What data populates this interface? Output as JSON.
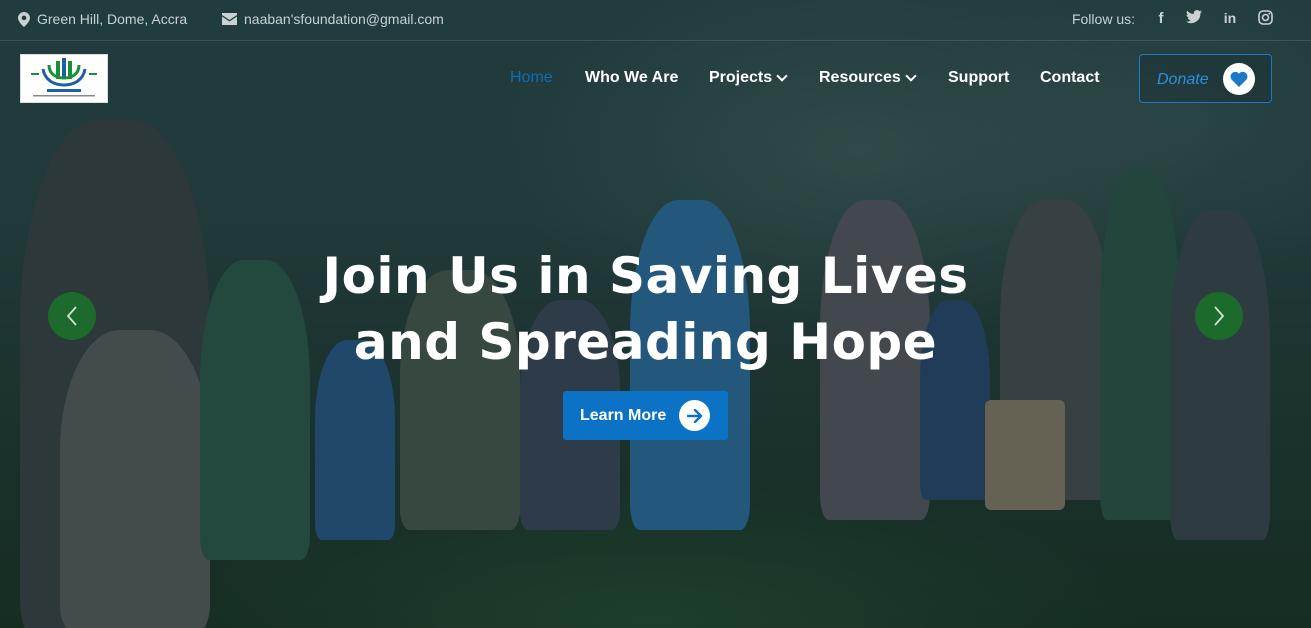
{
  "topbar": {
    "address": "Green Hill, Dome, Accra",
    "email": "naaban'sfoundation@gmail.com",
    "follow_label": "Follow us:",
    "social_icons": [
      "facebook-icon",
      "twitter-icon",
      "linkedin-icon",
      "instagram-icon"
    ]
  },
  "nav": {
    "items": [
      {
        "label": "Home",
        "active": true
      },
      {
        "label": "Who We Are"
      },
      {
        "label": "Projects",
        "dropdown": true
      },
      {
        "label": "Resources",
        "dropdown": true
      },
      {
        "label": "Support"
      },
      {
        "label": "Contact"
      }
    ],
    "donate_label": "Donate"
  },
  "hero": {
    "headline_line1": "Join Us in Saving Lives",
    "headline_line2": "and Spreading Hope",
    "cta_label": "Learn More"
  },
  "colors": {
    "accent": "#0b72c5",
    "carousel": "#1d6b2c",
    "active_nav": "#0d6db3"
  }
}
